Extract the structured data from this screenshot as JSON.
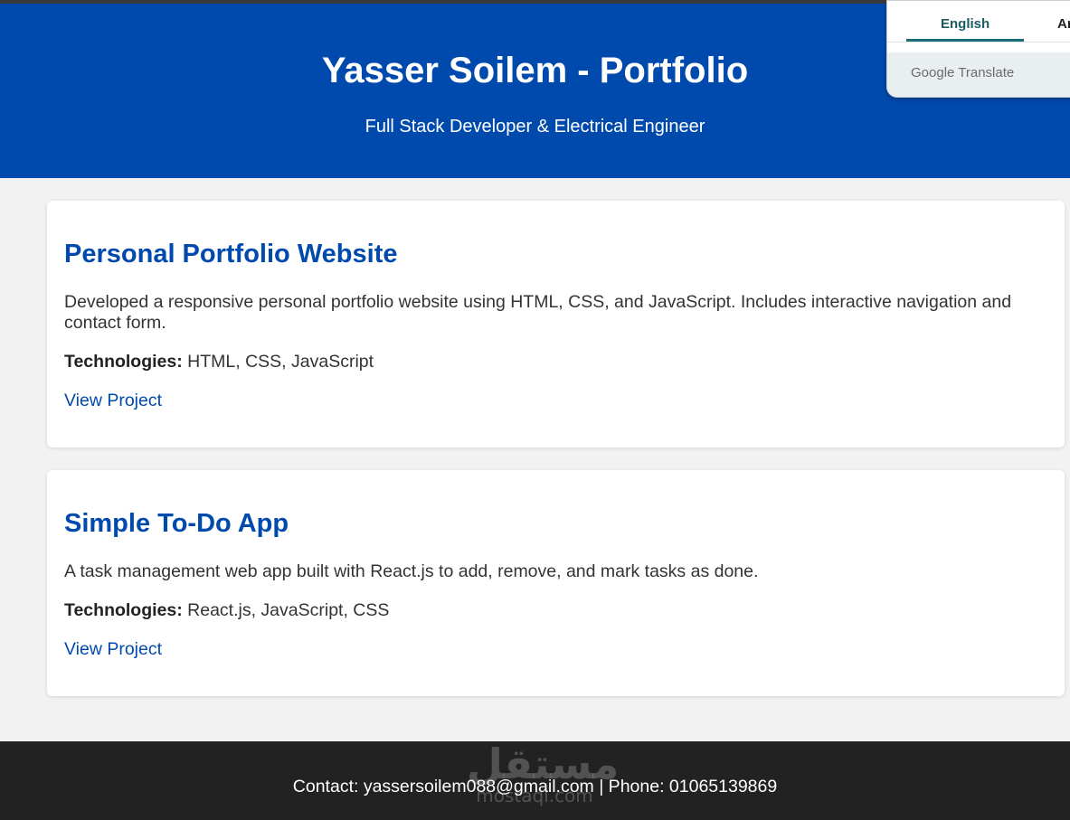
{
  "header": {
    "title": "Yasser Soilem - Portfolio",
    "subtitle": "Full Stack Developer & Electrical Engineer"
  },
  "translate_widget": {
    "tabs": [
      {
        "label": "English",
        "active": true
      },
      {
        "label": "Ar",
        "active": false
      }
    ],
    "brand": "Google Translate"
  },
  "projects": [
    {
      "title": "Personal Portfolio Website",
      "description": "Developed a responsive personal portfolio website using HTML, CSS, and JavaScript. Includes interactive navigation and contact form.",
      "tech_label": "Technologies:",
      "tech_value": " HTML, CSS, JavaScript",
      "link_label": "View Project"
    },
    {
      "title": "Simple To-Do App",
      "description": "A task management web app built with React.js to add, remove, and mark tasks as done.",
      "tech_label": "Technologies:",
      "tech_value": " React.js, JavaScript, CSS",
      "link_label": "View Project"
    }
  ],
  "footer": {
    "contact": "Contact: yassersoilem088@gmail.com | Phone: 01065139869"
  },
  "watermark": {
    "arabic": "مستقل",
    "latin": "mostaql.com"
  },
  "colors": {
    "brand_blue": "#004aad",
    "footer_bg": "#222222",
    "page_bg": "#f2f2f2"
  }
}
